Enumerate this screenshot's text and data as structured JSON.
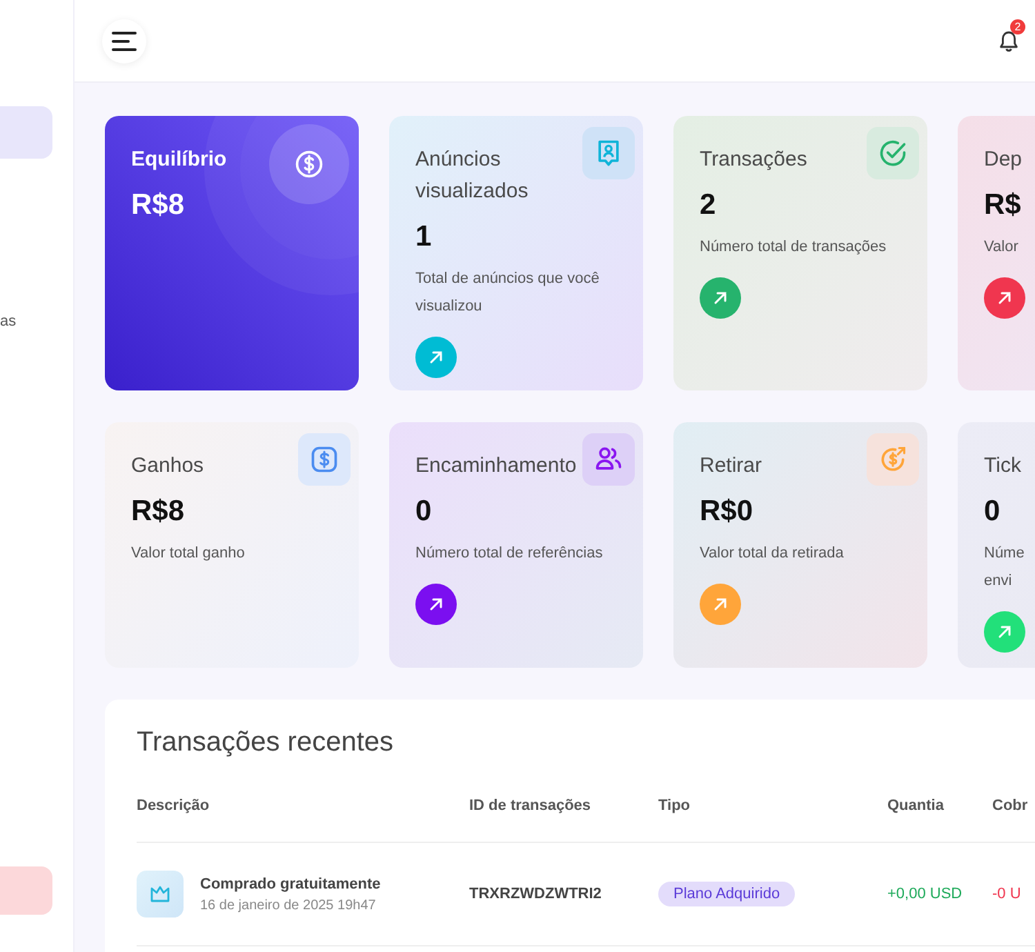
{
  "sidebar": {
    "items": [
      {
        "kind": "nav",
        "selected": true
      },
      {
        "kind": "nav",
        "label": "as",
        "selected": false
      },
      {
        "kind": "logout"
      }
    ]
  },
  "header": {
    "notifications": "2"
  },
  "cards": [
    {
      "kind": "balance",
      "title": "Equilíbrio",
      "value": "R$8"
    },
    {
      "kind": "stat",
      "title": "Anúncios visualizados",
      "value": "1",
      "description": "Total de anúncios que você visualizou",
      "color": "#00bcd4"
    },
    {
      "kind": "stat",
      "title": "Transações",
      "value": "2",
      "description": "Número total de transações",
      "color": "#26b36d"
    },
    {
      "kind": "stat",
      "title": "Dep",
      "value": "R$",
      "description": "Valor",
      "color": "#f0364f"
    },
    {
      "kind": "stat",
      "title": "Ganhos",
      "value": "R$8",
      "description": "Valor total ganho"
    },
    {
      "kind": "stat",
      "title": "Encaminhamento",
      "value": "0",
      "description": "Número total de referências",
      "color": "#7b0ff0"
    },
    {
      "kind": "stat",
      "title": "Retirar",
      "value": "R$0",
      "description": "Valor total da retirada",
      "color": "#ffa53a"
    },
    {
      "kind": "stat",
      "title": "Tick",
      "value": "0",
      "description": "Núme envi",
      "color": "#22e07a"
    }
  ],
  "transactions": {
    "title": "Transações recentes",
    "columns": [
      "Descrição",
      "ID de transações",
      "Tipo",
      "Quantia",
      "Cobr"
    ],
    "rows": [
      {
        "description": "Comprado gratuitamente",
        "date": "16 de janeiro de 2025 19h47",
        "id": "TRXRZWDZWTRI2",
        "type": "Plano Adquirido",
        "amount": "+0,00 USD",
        "charge": "-0 U"
      }
    ]
  }
}
